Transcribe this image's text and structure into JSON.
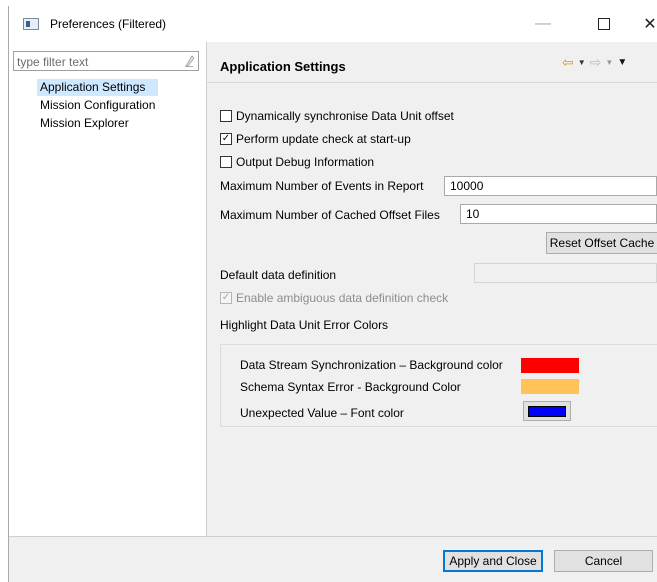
{
  "window": {
    "title": "Preferences (Filtered)",
    "controls": {
      "minimize": "—",
      "maximize": "",
      "close": "✕"
    }
  },
  "sidebar": {
    "filter_placeholder": "type filter text",
    "items": [
      {
        "label": "Application Settings",
        "selected": true
      },
      {
        "label": "Mission Configuration",
        "selected": false
      },
      {
        "label": "Mission Explorer",
        "selected": false
      }
    ]
  },
  "page": {
    "title": "Application Settings",
    "nav": {
      "back_icon": "⇦",
      "forward_icon": "⇨",
      "dropdown": "▼",
      "menu": "▼"
    },
    "checkboxes": [
      {
        "label": "Dynamically synchronise Data Unit offset",
        "checked": false
      },
      {
        "label": "Perform update check at start-up",
        "checked": true
      },
      {
        "label": "Output Debug Information",
        "checked": false
      }
    ],
    "max_events": {
      "label": "Maximum Number of Events in Report",
      "value": "10000"
    },
    "max_cached": {
      "label": "Maximum Number of Cached Offset Files",
      "value": "10"
    },
    "reset_button": "Reset Offset Cache",
    "default_def": {
      "label": "Default data definition",
      "value": ""
    },
    "ambiguous_check": {
      "label": "Enable ambiguous data definition check",
      "checked": true,
      "disabled": true
    },
    "highlight_label": "Highlight Data Unit Error Colors",
    "colors": [
      {
        "label": "Data Stream Synchronization – Background color",
        "color": "#ff0000"
      },
      {
        "label": "Schema Syntax Error - Background Color",
        "color": "#ffc35a"
      },
      {
        "label": "Unexpected Value – Font color",
        "color": "#0000ff"
      }
    ]
  },
  "footer": {
    "apply_label": "Apply and Close",
    "cancel_label": "Cancel"
  }
}
